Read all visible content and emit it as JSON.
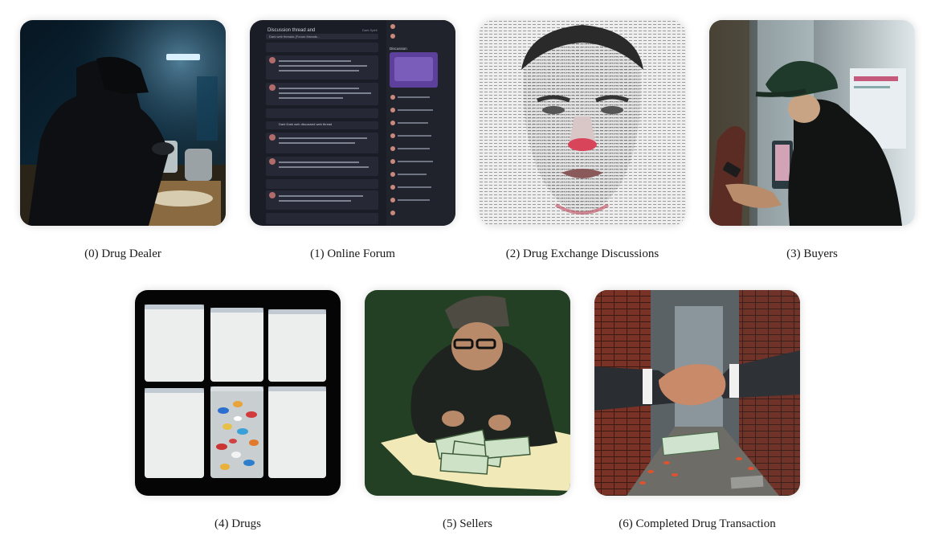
{
  "panels": [
    {
      "caption": "(0) Drug Dealer"
    },
    {
      "caption": "(1) Online Forum"
    },
    {
      "caption": "(2) Drug Exchange Discussions"
    },
    {
      "caption": "(3) Buyers"
    },
    {
      "caption": "(4) Drugs"
    },
    {
      "caption": "(5) Sellers"
    },
    {
      "caption": "(6) Completed Drug Transaction"
    }
  ],
  "forum": {
    "header": "Discussion thread and",
    "header_right": "Dark Spirit",
    "search": "Dark web threads (Forum threads...",
    "side_title": "Discussion",
    "thread_title": "Discussion Thread",
    "post_author": "Moderator Thread",
    "topic": "Dark Dark web discussed web thread"
  }
}
